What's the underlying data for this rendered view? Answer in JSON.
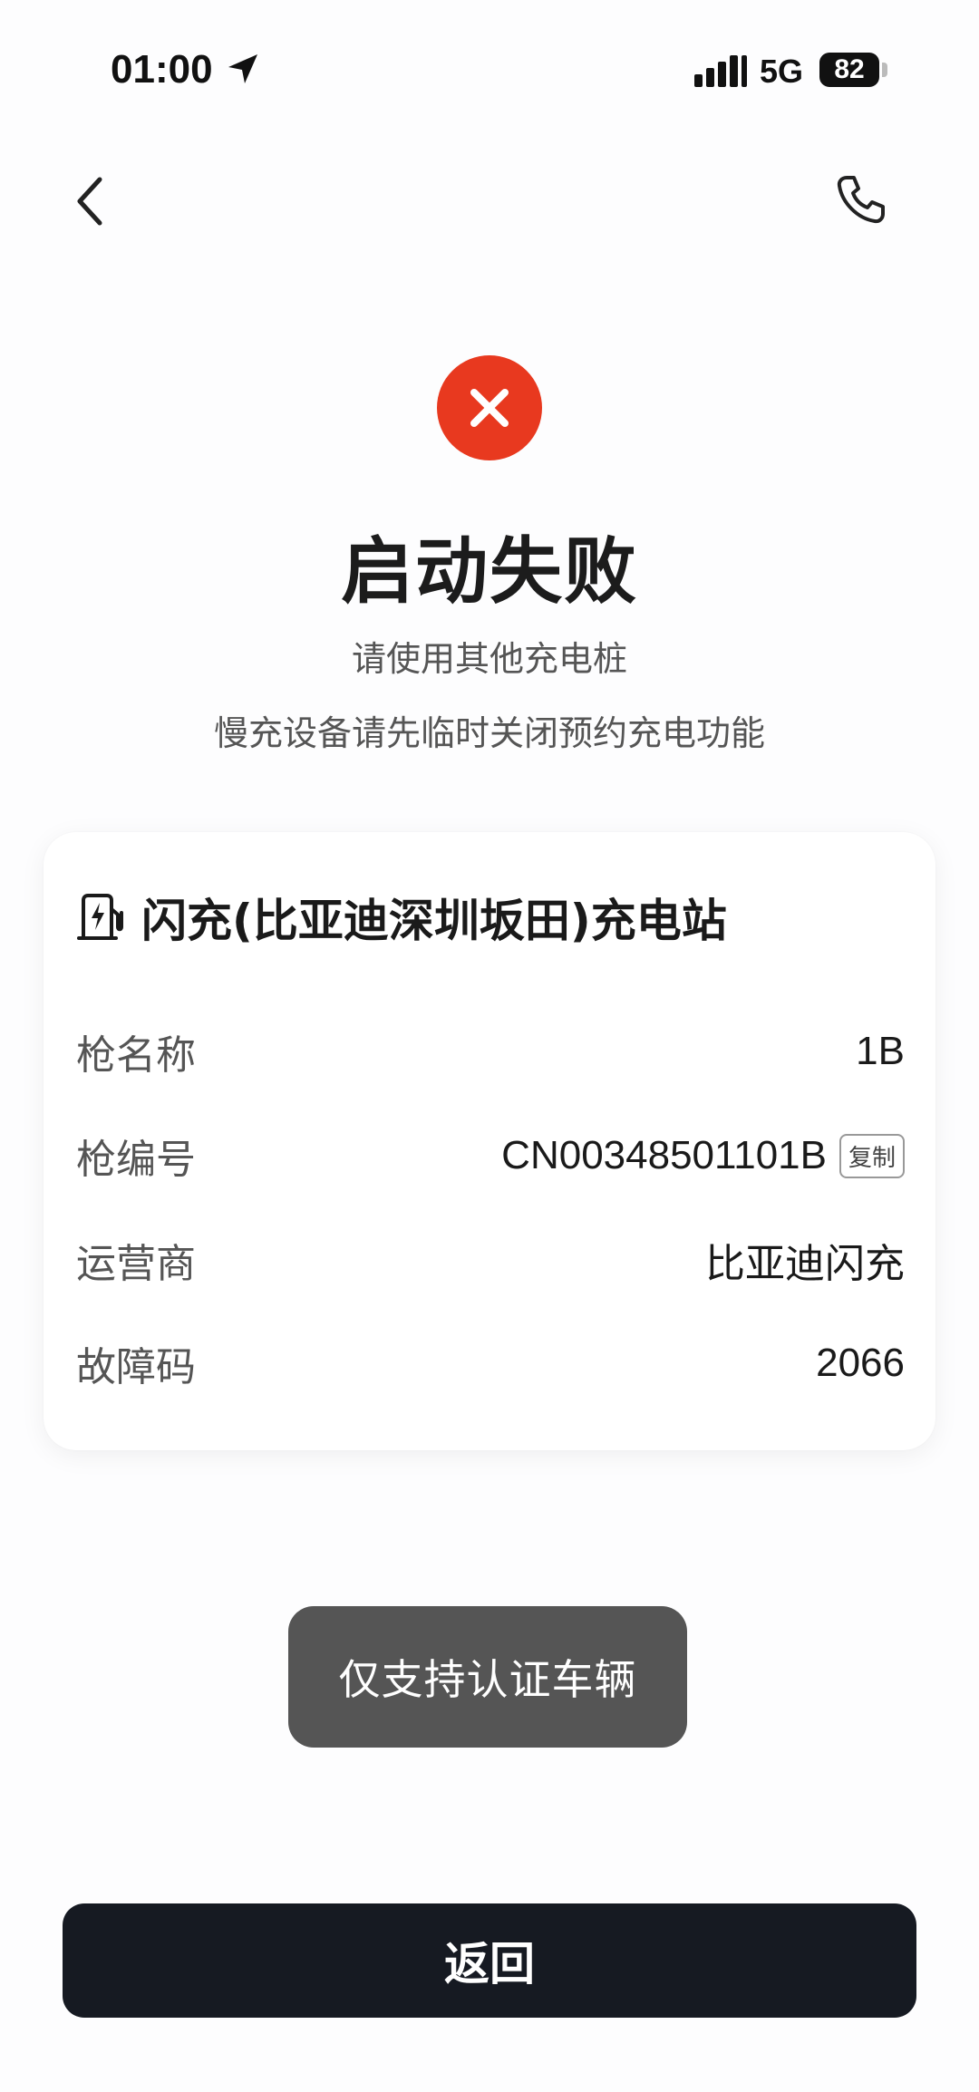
{
  "status_bar": {
    "time": "01:00",
    "network": "5G",
    "battery": "82"
  },
  "icons": {
    "back": "chevron-left-icon",
    "phone": "phone-icon",
    "fail": "close-circle-icon",
    "charger": "charger-icon"
  },
  "colors": {
    "fail_red": "#e8391f",
    "button_dark": "#161a22",
    "toast_bg": "#555555"
  },
  "result": {
    "title": "启动失败",
    "subtitle_1": "请使用其他充电桩",
    "subtitle_2": "慢充设备请先临时关闭预约充电功能"
  },
  "card": {
    "station_name": "闪充(比亚迪深圳坂田)充电站",
    "rows": [
      {
        "label": "枪名称",
        "value": "1B"
      },
      {
        "label": "枪编号",
        "value": "CN00348501101B",
        "action": "复制"
      },
      {
        "label": "运营商",
        "value": "比亚迪闪充"
      },
      {
        "label": "故障码",
        "value": "2066"
      }
    ]
  },
  "toast": {
    "text": "仅支持认证车辆"
  },
  "footer": {
    "return_label": "返回"
  }
}
